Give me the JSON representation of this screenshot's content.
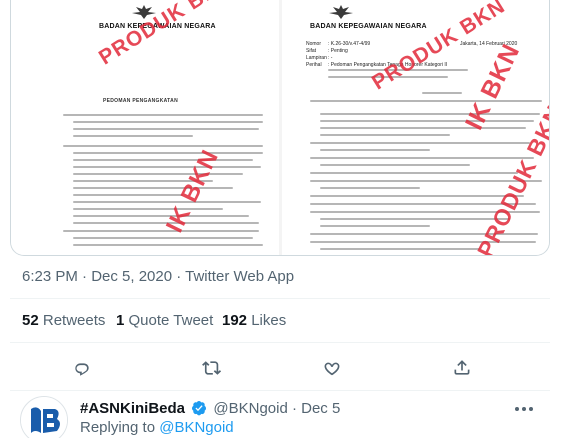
{
  "media": {
    "left_doc": {
      "agency": "BADAN KEPEGAWAIAN NEGARA",
      "heading": "PEDOMAN PENGANGKATAN",
      "stamps": [
        "PRODUK BKN",
        "IK BKN"
      ]
    },
    "right_doc": {
      "agency": "BADAN KEPEGAWAIAN NEGARA",
      "meta": [
        {
          "label": "Nomor",
          "value": ": K.26-30/v.47-4/99"
        },
        {
          "label": "Sifat",
          "value": ": Penting"
        },
        {
          "label": "Lampiran",
          "value": ": -"
        },
        {
          "label": "Perihal",
          "value": ": Pedoman Pengangkatan Tenaga Honorer Kategori II"
        }
      ],
      "date": "Jakarta, 14 Februari 2020",
      "stamps": [
        "PRODUK BKN",
        "IK BKN"
      ]
    }
  },
  "tweet": {
    "timestamp": "6:23 PM · Dec 5, 2020 · Twitter Web App",
    "retweets_count": "52",
    "retweets_label": "Retweets",
    "quotes_count": "1",
    "quotes_label": "Quote Tweet",
    "likes_count": "192",
    "likes_label": "Likes"
  },
  "actions": {
    "reply": "reply-icon",
    "retweet": "retweet-icon",
    "like": "heart-icon",
    "share": "share-icon"
  },
  "reply": {
    "name": "#ASNKiniBeda",
    "handle": "@BKNgoid · Dec 5",
    "replying_prefix": "Replying to ",
    "replying_to": "@BKNgoid"
  },
  "colors": {
    "stamp_red": "#e2293a",
    "link_blue": "#1d9bf0",
    "secondary_text": "#536471"
  }
}
